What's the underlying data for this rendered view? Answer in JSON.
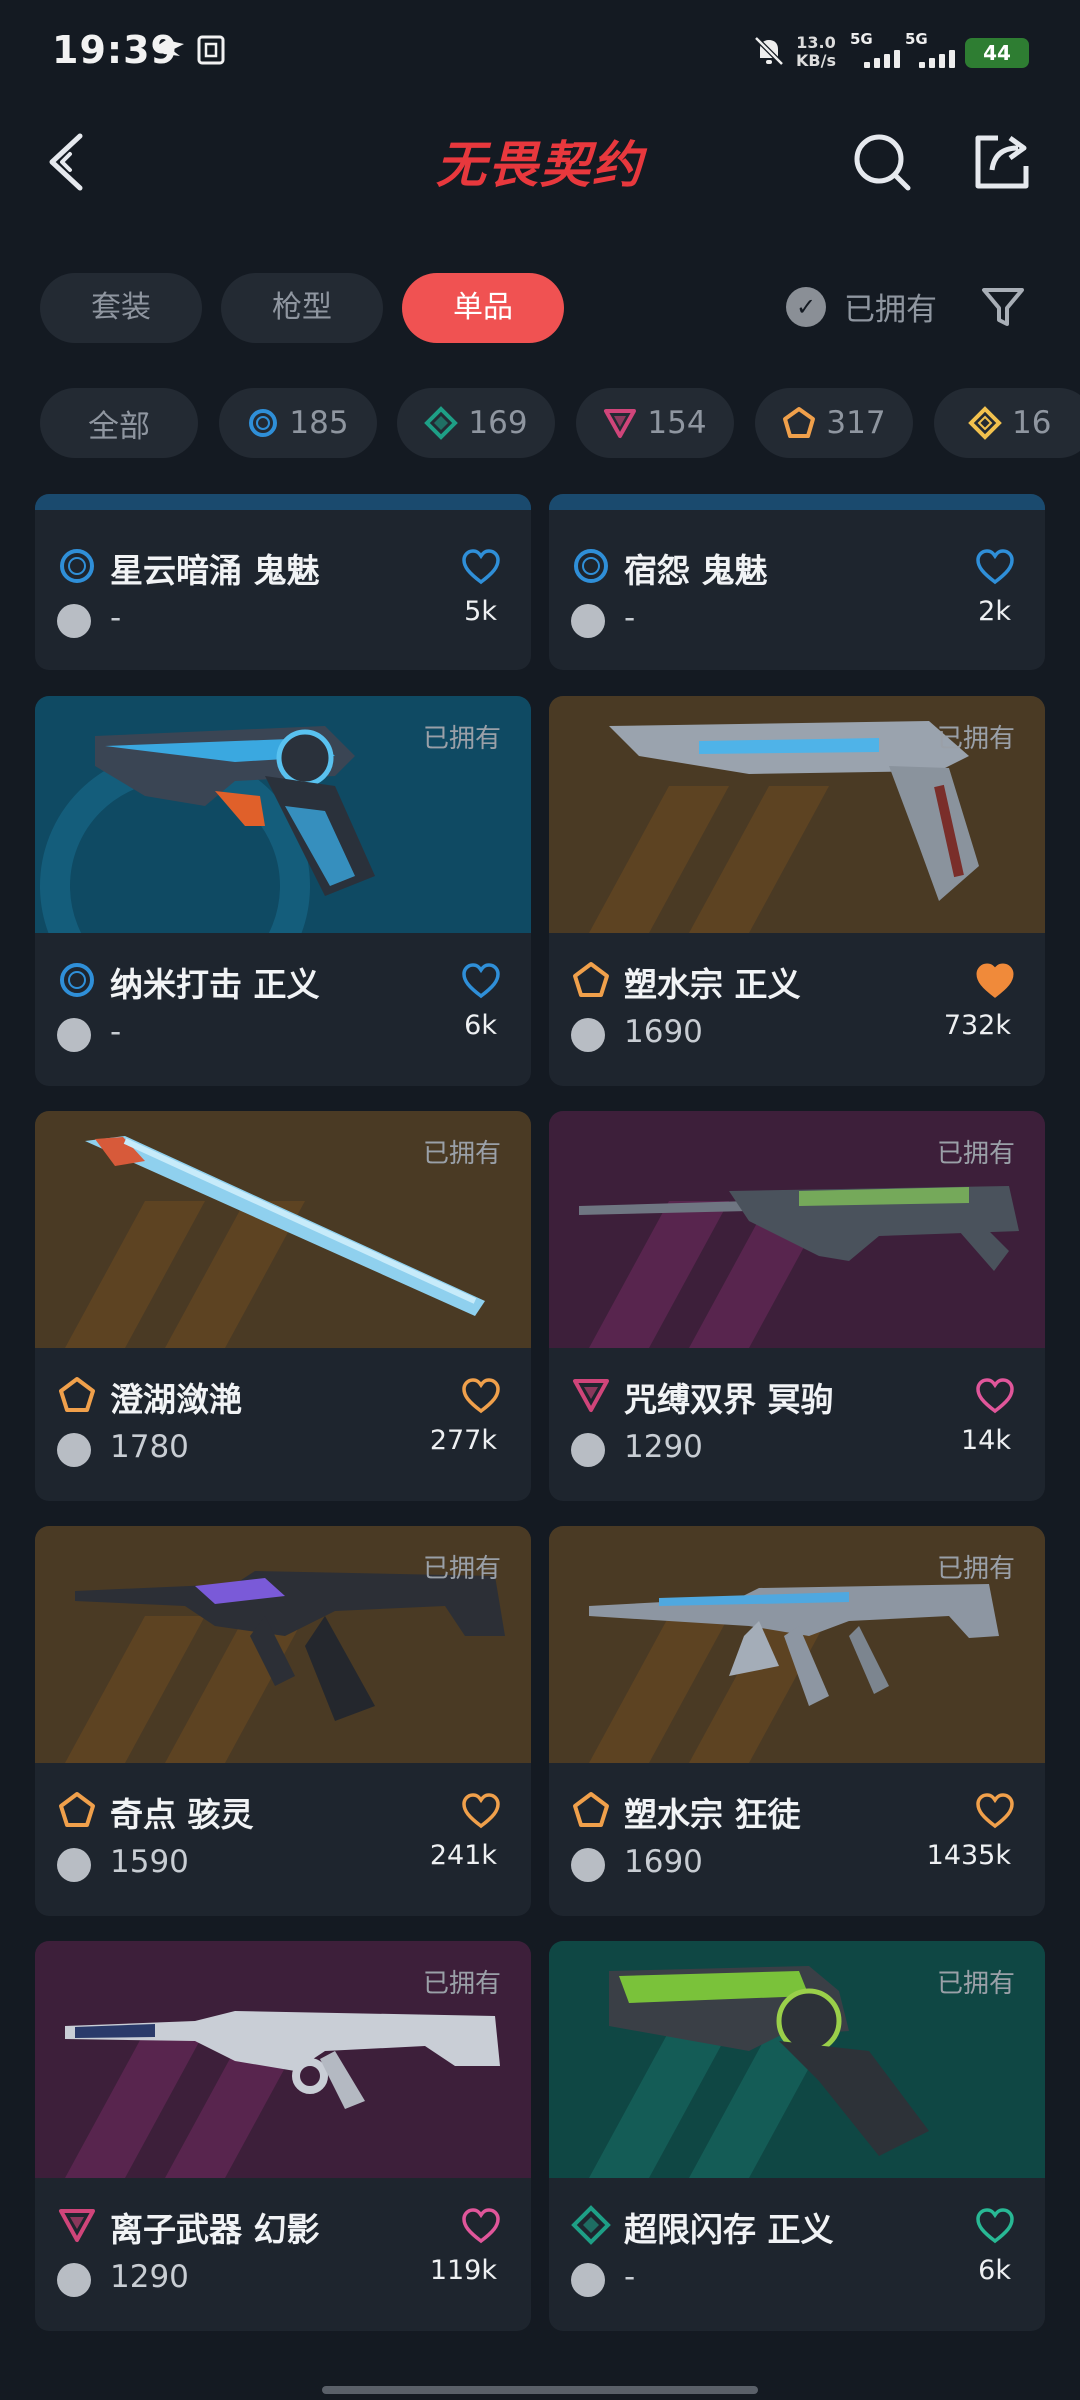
{
  "status_bar": {
    "time": "19:39",
    "net_speed_value": "13.0",
    "net_speed_unit": "KB/s",
    "sim1": "5G",
    "sim2": "5G",
    "battery": "44"
  },
  "header": {
    "title": "无畏契约"
  },
  "type_tabs": [
    {
      "label": "套装",
      "active": false
    },
    {
      "label": "枪型",
      "active": false
    },
    {
      "label": "单品",
      "active": true
    }
  ],
  "owned_filter": {
    "label": "已拥有",
    "check": "✓"
  },
  "rarity_chips": [
    {
      "label": "全部",
      "icon": "none"
    },
    {
      "label": "185",
      "icon": "select-circle-icon",
      "color": "#2f8fd8"
    },
    {
      "label": "169",
      "icon": "deluxe-diamond-icon",
      "color": "#1e9f86"
    },
    {
      "label": "154",
      "icon": "premium-triangle-icon",
      "color": "#d0457a"
    },
    {
      "label": "317",
      "icon": "exclusive-pentagon-icon",
      "color": "#f0a04b"
    },
    {
      "label": "16",
      "icon": "ultra-diamond-icon",
      "color": "#f2c14e"
    }
  ],
  "cards": [
    {
      "name": "星云暗涌 鬼魅",
      "rarity_icon": "select-circle-icon",
      "rarity_color": "#2f8fd8",
      "price": "-",
      "likes": "5k",
      "heart": "outline",
      "heart_color": "#2f8fd8",
      "owned": ""
    },
    {
      "name": "宿怨 鬼魅",
      "rarity_icon": "select-circle-icon",
      "rarity_color": "#2f8fd8",
      "price": "-",
      "likes": "2k",
      "heart": "outline",
      "heart_color": "#2f8fd8",
      "owned": ""
    },
    {
      "name": "纳米打击 正义",
      "rarity_icon": "select-circle-icon",
      "rarity_color": "#2f8fd8",
      "price": "-",
      "likes": "6k",
      "heart": "outline",
      "heart_color": "#2f8fd8",
      "owned": "已拥有",
      "bg": "blue",
      "weapon": "revolver-blue"
    },
    {
      "name": "塑水宗 正义",
      "rarity_icon": "exclusive-pentagon-icon",
      "rarity_color": "#f0a04b",
      "price": "1690",
      "likes": "732k",
      "heart": "filled",
      "heart_color": "#f08a3a",
      "owned": "已拥有",
      "bg": "orange",
      "weapon": "revolver-silver"
    },
    {
      "name": "澄湖潋滟",
      "rarity_icon": "exclusive-pentagon-icon",
      "rarity_color": "#f0a04b",
      "price": "1780",
      "likes": "277k",
      "heart": "outline",
      "heart_color": "#f0a04b",
      "owned": "已拥有",
      "bg": "orange",
      "weapon": "fan"
    },
    {
      "name": "咒缚双界 冥驹",
      "rarity_icon": "premium-triangle-icon",
      "rarity_color": "#d0457a",
      "price": "1290",
      "likes": "14k",
      "heart": "outline",
      "heart_color": "#e0569a",
      "owned": "已拥有",
      "bg": "magenta",
      "weapon": "sniper"
    },
    {
      "name": "奇点 骇灵",
      "rarity_icon": "exclusive-pentagon-icon",
      "rarity_color": "#f0a04b",
      "price": "1590",
      "likes": "241k",
      "heart": "outline",
      "heart_color": "#f0a04b",
      "owned": "已拥有",
      "bg": "orange",
      "weapon": "smg-dark"
    },
    {
      "name": "塑水宗 狂徒",
      "rarity_icon": "exclusive-pentagon-icon",
      "rarity_color": "#f0a04b",
      "price": "1690",
      "likes": "1435k",
      "heart": "outline",
      "heart_color": "#f0a04b",
      "owned": "已拥有",
      "bg": "orange",
      "weapon": "rifle-silver"
    },
    {
      "name": "离子武器 幻影",
      "rarity_icon": "premium-triangle-icon",
      "rarity_color": "#d0457a",
      "price": "1290",
      "likes": "119k",
      "heart": "outline",
      "heart_color": "#e0569a",
      "owned": "已拥有",
      "bg": "magenta",
      "weapon": "rifle-white"
    },
    {
      "name": "超限闪存 正义",
      "rarity_icon": "deluxe-diamond-icon",
      "rarity_color": "#1e9f86",
      "price": "-",
      "likes": "6k",
      "heart": "outline",
      "heart_color": "#28b894",
      "owned": "已拥有",
      "bg": "teal",
      "weapon": "revolver-green"
    }
  ]
}
